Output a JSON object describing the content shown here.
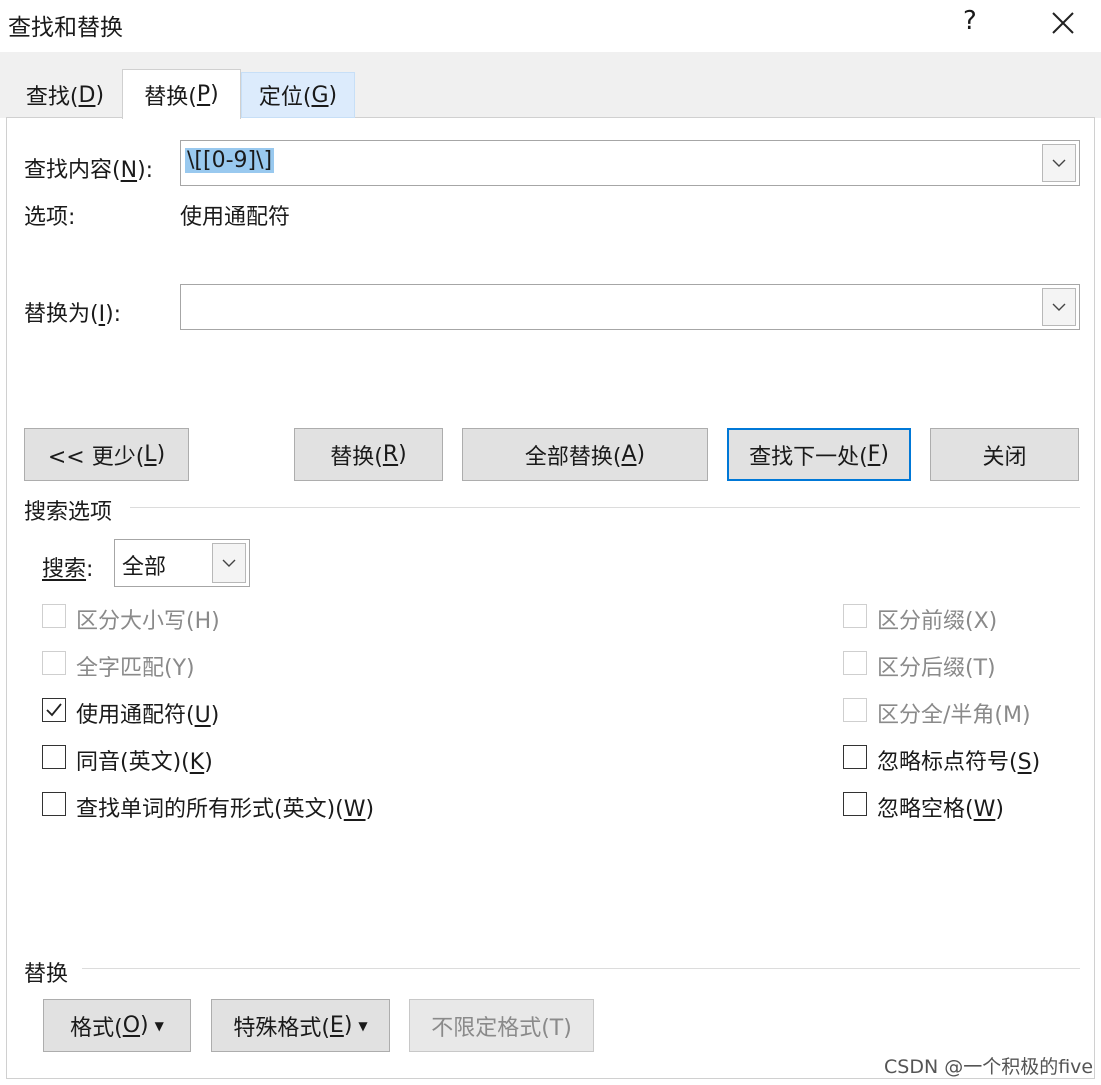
{
  "window": {
    "title": "查找和替换",
    "help": "?"
  },
  "tabs": [
    {
      "pre": "查找(",
      "key": "D",
      "post": ")"
    },
    {
      "pre": "替换(",
      "key": "P",
      "post": ")"
    },
    {
      "pre": "定位(",
      "key": "G",
      "post": ")"
    }
  ],
  "find": {
    "label_pre": "查找内容(",
    "label_key": "N",
    "label_post": "):",
    "value": "\\[[0-9]\\]"
  },
  "options_line": {
    "label": "选项:",
    "value": "使用通配符"
  },
  "replace": {
    "label_pre": "替换为(",
    "label_key": "I",
    "label_post": "):",
    "value": ""
  },
  "buttons": {
    "less": {
      "pre": "<< 更少(",
      "key": "L",
      "post": ")"
    },
    "replace": {
      "pre": "替换(",
      "key": "R",
      "post": ")"
    },
    "replace_all": {
      "pre": "全部替换(",
      "key": "A",
      "post": ")"
    },
    "find_next": {
      "pre": "查找下一处(",
      "key": "F",
      "post": ")"
    },
    "close": "关闭"
  },
  "search_options": {
    "heading": "搜索选项",
    "search_label": "搜索",
    "search_value": "全部",
    "left": [
      {
        "text": "区分大小写(H)",
        "checked": false,
        "disabled": true
      },
      {
        "text": "全字匹配(Y)",
        "checked": false,
        "disabled": true
      },
      {
        "pre": "使用通配符(",
        "key": "U",
        "post": ")",
        "checked": true,
        "disabled": false
      },
      {
        "pre": "同音(英文)(",
        "key": "K",
        "post": ")",
        "checked": false,
        "disabled": false
      },
      {
        "pre": "查找单词的所有形式(英文)(",
        "key": "W",
        "post": ")",
        "checked": false,
        "disabled": false
      }
    ],
    "right": [
      {
        "text": "区分前缀(X)",
        "checked": false,
        "disabled": true
      },
      {
        "text": "区分后缀(T)",
        "checked": false,
        "disabled": true
      },
      {
        "text": "区分全/半角(M)",
        "checked": false,
        "disabled": true
      },
      {
        "pre": "忽略标点符号(",
        "key": "S",
        "post": ")",
        "checked": false,
        "disabled": false
      },
      {
        "pre": "忽略空格(",
        "key": "W",
        "post": ")",
        "checked": false,
        "disabled": false
      }
    ]
  },
  "replace_section": {
    "heading": "替换",
    "format": {
      "pre": "格式(",
      "key": "O",
      "post": ")"
    },
    "special": {
      "pre": "特殊格式(",
      "key": "E",
      "post": ")"
    },
    "no_format": "不限定格式(T)"
  },
  "watermark": "CSDN @一个积极的five",
  "colors": {
    "accent": "#0078d7",
    "selection": "#99c9ef",
    "tab_hover": "#dcebfc"
  }
}
